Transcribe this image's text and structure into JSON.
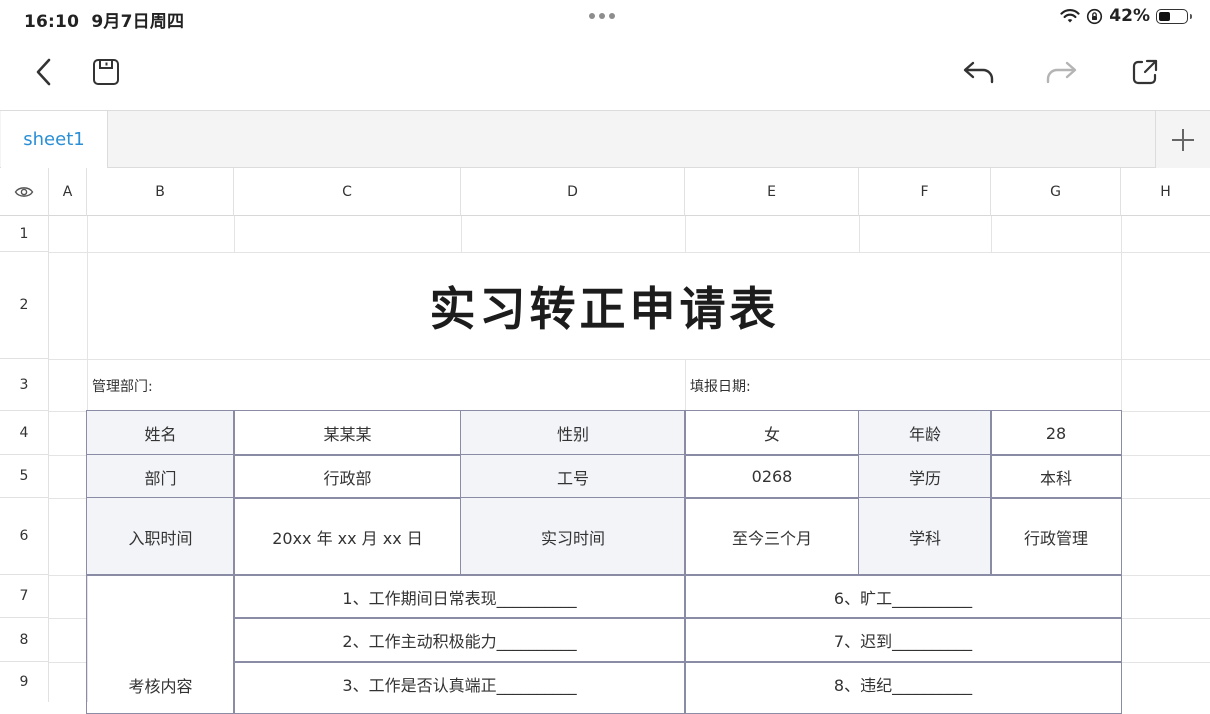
{
  "status": {
    "time": "16:10",
    "date": "9月7日周四",
    "battery": "42%",
    "battery_level": 0.42
  },
  "tabs": [
    {
      "label": "sheet1"
    }
  ],
  "columns": [
    "A",
    "B",
    "C",
    "D",
    "E",
    "F",
    "G",
    "H"
  ],
  "rows": [
    "1",
    "2",
    "3",
    "4",
    "5",
    "6",
    "7",
    "8",
    "9"
  ],
  "sheet": {
    "title": "实习转正申请表",
    "dept_manage": "管理部门:",
    "fill_date": "填报日期:",
    "name_label": "姓名",
    "name_value": "某某某",
    "gender_label": "性别",
    "gender_value": "女",
    "age_label": "年龄",
    "age_value": "28",
    "dept_label": "部门",
    "dept_value": "行政部",
    "id_label": "工号",
    "id_value": "0268",
    "edu_label": "学历",
    "edu_value": "本科",
    "join_label": "入职时间",
    "join_value": "20xx 年 xx 月 xx 日",
    "intern_label": "实习时间",
    "intern_value": "至今三个月",
    "subject_label": "学科",
    "subject_value": "行政管理",
    "assess_label": "考核内容",
    "assess_items": [
      "1、工作期间日常表现__________",
      "2、工作主动积极能力__________",
      "3、工作是否认真端正__________"
    ],
    "assess_items_right": [
      "6、旷工__________",
      "7、迟到__________",
      "8、违纪__________"
    ]
  }
}
